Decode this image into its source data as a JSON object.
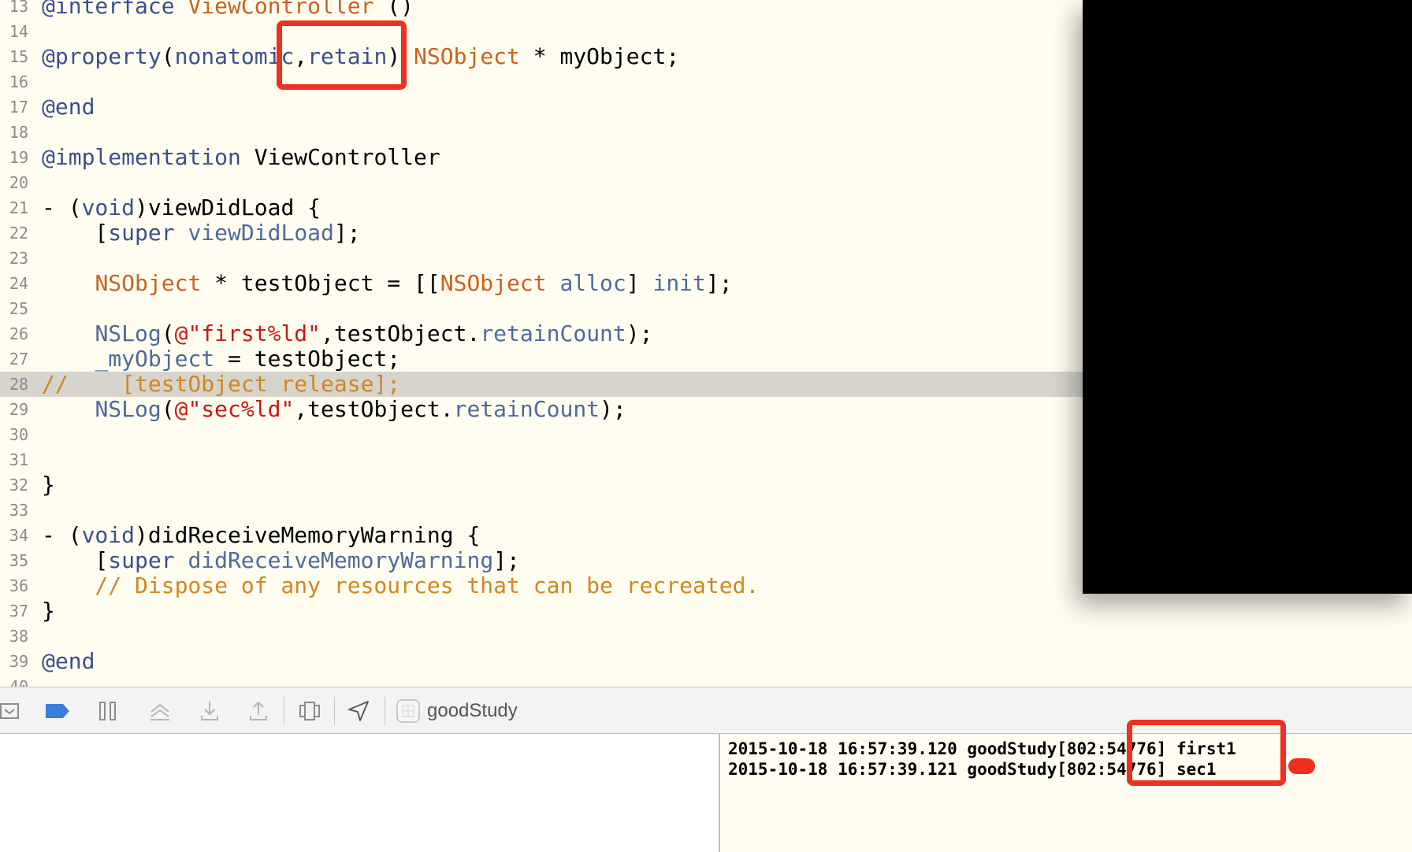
{
  "editor": {
    "lines": [
      {
        "n": "13",
        "parts": [
          {
            "t": "@interface",
            "c": "kw"
          },
          {
            "t": " "
          },
          {
            "t": "ViewController",
            "c": "cls"
          },
          {
            "t": " ()"
          }
        ]
      },
      {
        "n": "14",
        "parts": []
      },
      {
        "n": "15",
        "parts": [
          {
            "t": "@property",
            "c": "kw"
          },
          {
            "t": "("
          },
          {
            "t": "nonatomic",
            "c": "kw"
          },
          {
            "t": ","
          },
          {
            "t": "retain",
            "c": "kw"
          },
          {
            "t": ") "
          },
          {
            "t": "NSObject",
            "c": "cls"
          },
          {
            "t": " * myObject;"
          }
        ]
      },
      {
        "n": "16",
        "parts": []
      },
      {
        "n": "17",
        "parts": [
          {
            "t": "@end",
            "c": "kw"
          }
        ]
      },
      {
        "n": "18",
        "parts": []
      },
      {
        "n": "19",
        "parts": [
          {
            "t": "@implementation",
            "c": "kw"
          },
          {
            "t": " ViewController"
          }
        ]
      },
      {
        "n": "20",
        "parts": []
      },
      {
        "n": "21",
        "parts": [
          {
            "t": "- ("
          },
          {
            "t": "void",
            "c": "kw"
          },
          {
            "t": ")viewDidLoad {"
          }
        ]
      },
      {
        "n": "22",
        "parts": [
          {
            "t": "    ["
          },
          {
            "t": "super",
            "c": "kw"
          },
          {
            "t": " "
          },
          {
            "t": "viewDidLoad",
            "c": "fn"
          },
          {
            "t": "];"
          }
        ]
      },
      {
        "n": "23",
        "parts": []
      },
      {
        "n": "24",
        "parts": [
          {
            "t": "    "
          },
          {
            "t": "NSObject",
            "c": "cls"
          },
          {
            "t": " * testObject = [["
          },
          {
            "t": "NSObject",
            "c": "cls"
          },
          {
            "t": " "
          },
          {
            "t": "alloc",
            "c": "fn"
          },
          {
            "t": "] "
          },
          {
            "t": "init",
            "c": "fn"
          },
          {
            "t": "];"
          }
        ]
      },
      {
        "n": "25",
        "parts": []
      },
      {
        "n": "26",
        "parts": [
          {
            "t": "    "
          },
          {
            "t": "NSLog",
            "c": "fn"
          },
          {
            "t": "("
          },
          {
            "t": "@\"first%ld\"",
            "c": "str"
          },
          {
            "t": ",testObject."
          },
          {
            "t": "retainCount",
            "c": "fn"
          },
          {
            "t": ");"
          }
        ]
      },
      {
        "n": "27",
        "parts": [
          {
            "t": "    "
          },
          {
            "t": "_myObject",
            "c": "fn"
          },
          {
            "t": " = testObject;"
          }
        ]
      },
      {
        "n": "28",
        "hl": true,
        "parts": [
          {
            "t": "//    [testObject release];",
            "c": "cmt"
          }
        ]
      },
      {
        "n": "29",
        "parts": [
          {
            "t": "    "
          },
          {
            "t": "NSLog",
            "c": "fn"
          },
          {
            "t": "("
          },
          {
            "t": "@\"sec%ld\"",
            "c": "str"
          },
          {
            "t": ",testObject."
          },
          {
            "t": "retainCount",
            "c": "fn"
          },
          {
            "t": ");"
          }
        ]
      },
      {
        "n": "30",
        "parts": []
      },
      {
        "n": "31",
        "parts": []
      },
      {
        "n": "32",
        "parts": [
          {
            "t": "}"
          }
        ]
      },
      {
        "n": "33",
        "parts": []
      },
      {
        "n": "34",
        "parts": [
          {
            "t": "- ("
          },
          {
            "t": "void",
            "c": "kw"
          },
          {
            "t": ")didReceiveMemoryWarning {"
          }
        ]
      },
      {
        "n": "35",
        "parts": [
          {
            "t": "    ["
          },
          {
            "t": "super",
            "c": "kw"
          },
          {
            "t": " "
          },
          {
            "t": "didReceiveMemoryWarning",
            "c": "fn"
          },
          {
            "t": "];"
          }
        ]
      },
      {
        "n": "36",
        "parts": [
          {
            "t": "    // Dispose of any resources that can be recreated.",
            "c": "cmt"
          }
        ]
      },
      {
        "n": "37",
        "parts": [
          {
            "t": "}"
          }
        ]
      },
      {
        "n": "38",
        "parts": []
      },
      {
        "n": "39",
        "parts": [
          {
            "t": "@end",
            "c": "kw"
          }
        ]
      },
      {
        "n": "40",
        "parts": []
      }
    ]
  },
  "toolbar": {
    "scheme_label": "goodStudy",
    "icons": [
      "hide-console-icon",
      "breakpoint-icon",
      "pause-icon",
      "step-over-icon",
      "step-into-icon",
      "step-out-icon",
      "view-hierarchy-icon",
      "location-icon",
      "scheme-app-icon"
    ]
  },
  "console": {
    "lines": [
      "2015-10-18 16:57:39.120 goodStudy[802:54776] first1",
      "2015-10-18 16:57:39.121 goodStudy[802:54776] sec1"
    ]
  },
  "colors": {
    "editor_bg": "#fffdf0",
    "keyword": "#3b4f8c",
    "class_name": "#c8621f",
    "string": "#c41a16",
    "comment": "#d0871f",
    "method": "#4e6a9c",
    "annotation": "#f0301f"
  }
}
